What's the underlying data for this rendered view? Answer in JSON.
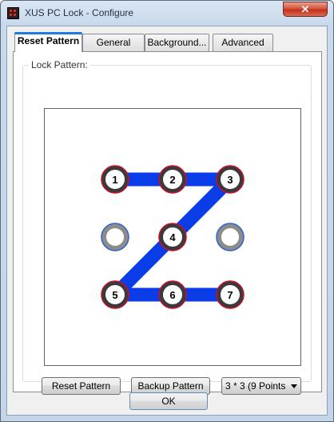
{
  "window": {
    "title": "XUS PC Lock - Configure",
    "close_glyph": "✕"
  },
  "tabs": [
    {
      "label": "Reset Pattern",
      "active": true
    },
    {
      "label": "General",
      "active": false
    },
    {
      "label": "Background...",
      "active": false
    },
    {
      "label": "Advanced",
      "active": false
    }
  ],
  "group": {
    "label": "Lock Pattern:"
  },
  "pattern": {
    "grid": "3x3",
    "points": [
      {
        "row": 0,
        "col": 0,
        "label": "1"
      },
      {
        "row": 0,
        "col": 1,
        "label": "2"
      },
      {
        "row": 0,
        "col": 2,
        "label": "3"
      },
      {
        "row": 1,
        "col": 0,
        "label": ""
      },
      {
        "row": 1,
        "col": 1,
        "label": "4"
      },
      {
        "row": 1,
        "col": 2,
        "label": ""
      },
      {
        "row": 2,
        "col": 0,
        "label": "5"
      },
      {
        "row": 2,
        "col": 1,
        "label": "6"
      },
      {
        "row": 2,
        "col": 2,
        "label": "7"
      }
    ],
    "path_order": [
      "1",
      "2",
      "3",
      "4",
      "5",
      "6",
      "7"
    ],
    "colors": {
      "line": "#0a3ce8",
      "selected_ring": "#c8102e",
      "unselected_ring": "#2f63c8"
    }
  },
  "buttons": {
    "reset_pattern": "Reset Pattern",
    "backup_pattern": "Backup Pattern",
    "ok": "OK"
  },
  "grid_select": {
    "value": "3 * 3 (9 Points"
  }
}
